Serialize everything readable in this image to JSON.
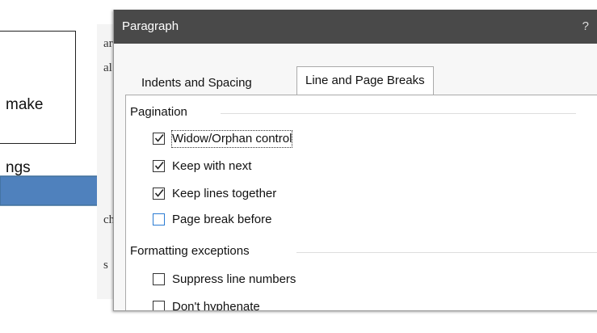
{
  "callout": {
    "lines": [
      "make",
      "ngs"
    ]
  },
  "background_fragments": [
    "ar",
    "al",
    "ch",
    "s"
  ],
  "dialog": {
    "title": "Paragraph",
    "help_glyph": "?",
    "tabs": [
      {
        "label": "Indents and Spacing",
        "active": false
      },
      {
        "label": "Line and Page Breaks",
        "active": true
      }
    ],
    "pagination": {
      "heading": "Pagination",
      "options": [
        {
          "label": "Widow/Orphan control",
          "checked": true
        },
        {
          "label": "Keep with next",
          "checked": true
        },
        {
          "label": "Keep lines together",
          "checked": true
        },
        {
          "label": "Page break before",
          "checked": false
        }
      ]
    },
    "formatting_exceptions": {
      "heading": "Formatting exceptions",
      "options": [
        {
          "label": "Suppress line numbers",
          "checked": false
        },
        {
          "label": "Don't hyphenate",
          "checked": false
        }
      ]
    }
  },
  "colors": {
    "titlebar": "#494949",
    "arrow": "#4f81bd",
    "focus_checkbox": "#2b7cd3"
  }
}
